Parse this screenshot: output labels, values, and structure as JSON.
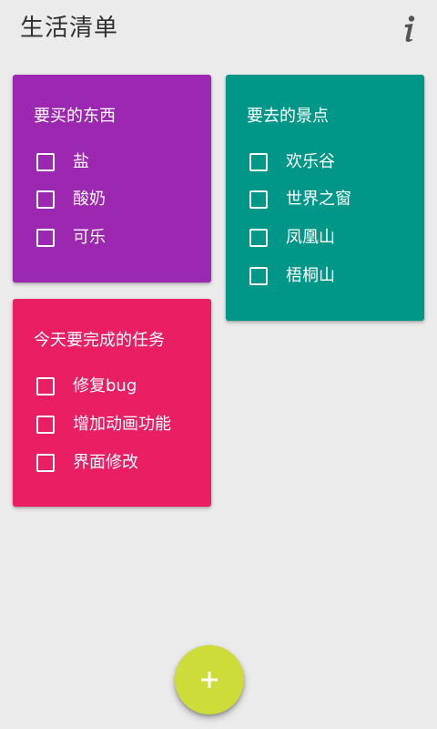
{
  "app_bar": {
    "title": "生活清单",
    "info_icon": "info-icon"
  },
  "colors": {
    "background": "#ebebeb",
    "card_shopping": "#9c27b0",
    "card_places": "#009688",
    "card_tasks": "#e91e63",
    "fab": "#cddc39"
  },
  "cards": [
    {
      "title": "要买的东西",
      "items": [
        {
          "label": "盐",
          "checked": false
        },
        {
          "label": "酸奶",
          "checked": false
        },
        {
          "label": "可乐",
          "checked": false
        }
      ]
    },
    {
      "title": "要去的景点",
      "items": [
        {
          "label": "欢乐谷",
          "checked": false
        },
        {
          "label": "世界之窗",
          "checked": false
        },
        {
          "label": "凤凰山",
          "checked": false
        },
        {
          "label": "梧桐山",
          "checked": false
        }
      ]
    },
    {
      "title": "今天要完成的任务",
      "items": [
        {
          "label": "修复bug",
          "checked": false
        },
        {
          "label": "增加动画功能",
          "checked": false
        },
        {
          "label": "界面修改",
          "checked": false
        }
      ]
    }
  ],
  "fab": {
    "icon": "plus-icon"
  }
}
